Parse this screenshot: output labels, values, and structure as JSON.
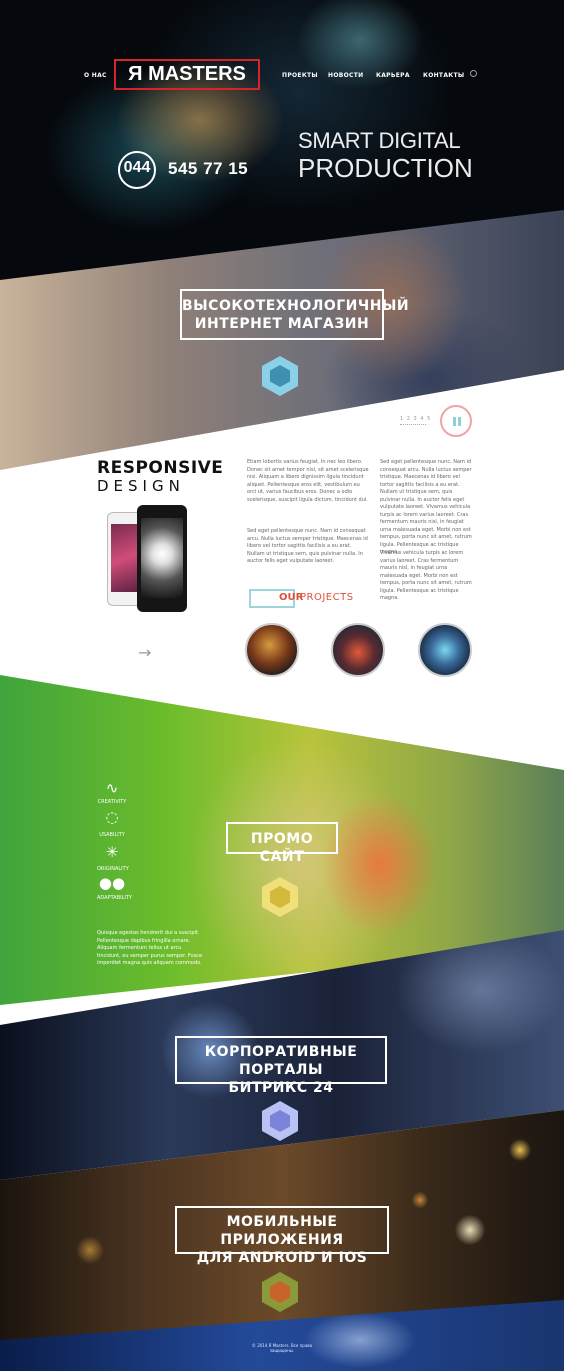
{
  "nav": {
    "about": "О НАС",
    "projects": "ПРОЕКТЫ",
    "news": "НОВОСТИ",
    "career": "КАРЬЕРА",
    "contacts": "КОНТАКТЫ"
  },
  "brand": {
    "logo": "Я MASTERS",
    "accent": "#d8232a"
  },
  "hero": {
    "phone_code": "044",
    "phone_number": "545 77 15",
    "tagline_line1": "SMART DIGITAL",
    "tagline_line2": "PRODUCTION"
  },
  "section_shop": {
    "title_line1": "ВЫСОКОТЕХНОЛОГИЧНЫЙ",
    "title_line2": "ИНТЕРНЕТ МАГАЗИН"
  },
  "slider": {
    "pages": "1 2 3 4 5"
  },
  "responsive": {
    "title_line1": "RESPONSIVE",
    "title_line2": "DESIGN",
    "para1": "Etiam lobortis varius feugiat. In nec leo libero. Donec sit amet tempor nisl, sit amet scelerisque nisi. Aliquam a libero dignissim ligula tincidunt aliquet. Pellentesque eros elit, vestibulum eu orci ut, varius faucibus eros. Donec a odio scelerisque, suscipit ligula dictum, tincidunt dui.",
    "para2": "Sed eget pellentesque nunc. Nam id consequat arcu. Nulla luctus semper tristique. Maecenas id libero vel tortor sagittis facilisis a eu erat. Nullam ut tristique sem, quis pulvinar nulla. In auctor felis eget vulputate laoreet.",
    "para3": "Sed eget pellentesque nunc. Nam id consequat arcu. Nulla luctus semper tristique. Maecenas id libero vel tortor sagittis facilisis a eu erat. Nullam ut tristique sem, quis pulvinar nulla. In auctor felis eget vulputate laoreet. Vivamus vehicula turpis ac lorem varius laoreet. Cras fermentum mauris nisl, in feugiat urna malesuada eget. Morbi non est tempus, porta nunc sit amet, rutrum ligula. Pellentesque ac tristique magna.",
    "para4": "Vivamus vehicula turpis ac lorem varius laoreet. Cras fermentum mauris nisl, in feugiat urna malesuada eget. Morbi non est tempus, porta nunc sit amet, rutrum ligula. Pellentesque ac tristique magna.",
    "projects_our": "OUR",
    "projects_label": "PROJECTS"
  },
  "section_promo": {
    "title": "ПРОМО САЙТ",
    "features": [
      "CREATIVITY",
      "USABILITY",
      "ORIGINALITY",
      "ADAPTABILITY"
    ],
    "text": "Quisque egestas hendrerit dui a suscipit. Pellentesque dapibus fringilla ornare. Aliquam fermentum tellus ut arcu tincidunt, eu semper purus semper. Fusce imperdiet magna quis aliquam commodo."
  },
  "section_portal": {
    "title_line1": "КОРПОРАТИВНЫЕ ПОРТАЛЫ",
    "title_line2": "БИТРИКС 24"
  },
  "section_mobile": {
    "title_line1": "МОБИЛЬНЫЕ ПРИЛОЖЕНИЯ",
    "title_line2": "ДЛЯ ANDROID И IOS"
  },
  "footer": {
    "copyright": "© 2014 Я Masters. Все права защищены."
  }
}
